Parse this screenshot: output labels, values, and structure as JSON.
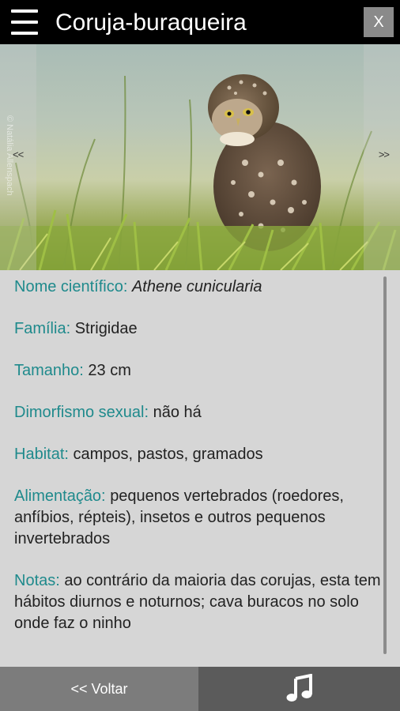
{
  "header": {
    "menu_icon": "hamburger-icon",
    "title": "Coruja-buraqueira",
    "close_label": "X"
  },
  "photo": {
    "credit": "© Natália Allenspach",
    "prev_label": "<<",
    "next_label": ">>"
  },
  "details": [
    {
      "label": "Nome científico:",
      "value": "Athene cunicularia",
      "italic": true
    },
    {
      "label": "Família:",
      "value": "Strigidae"
    },
    {
      "label": "Tamanho:",
      "value": "23 cm"
    },
    {
      "label": "Dimorfismo sexual:",
      "value": "não há"
    },
    {
      "label": "Habitat:",
      "value": "campos, pastos, gramados"
    },
    {
      "label": "Alimentação:",
      "value": "pequenos vertebrados (roedores, anfíbios, répteis), insetos e outros pequenos invertebrados"
    },
    {
      "label": "Notas:",
      "value": "ao contrário da maioria das corujas, esta tem hábitos diurnos e noturnos; cava buracos no solo onde faz o ninho"
    }
  ],
  "footer": {
    "back_label": "<< Voltar",
    "sound_icon": "music-note-icon"
  },
  "colors": {
    "label_teal": "#1f8a8c",
    "content_bg": "#d6d6d6",
    "back_bg": "#7c7c7c",
    "sound_bg": "#5b5b5b"
  }
}
